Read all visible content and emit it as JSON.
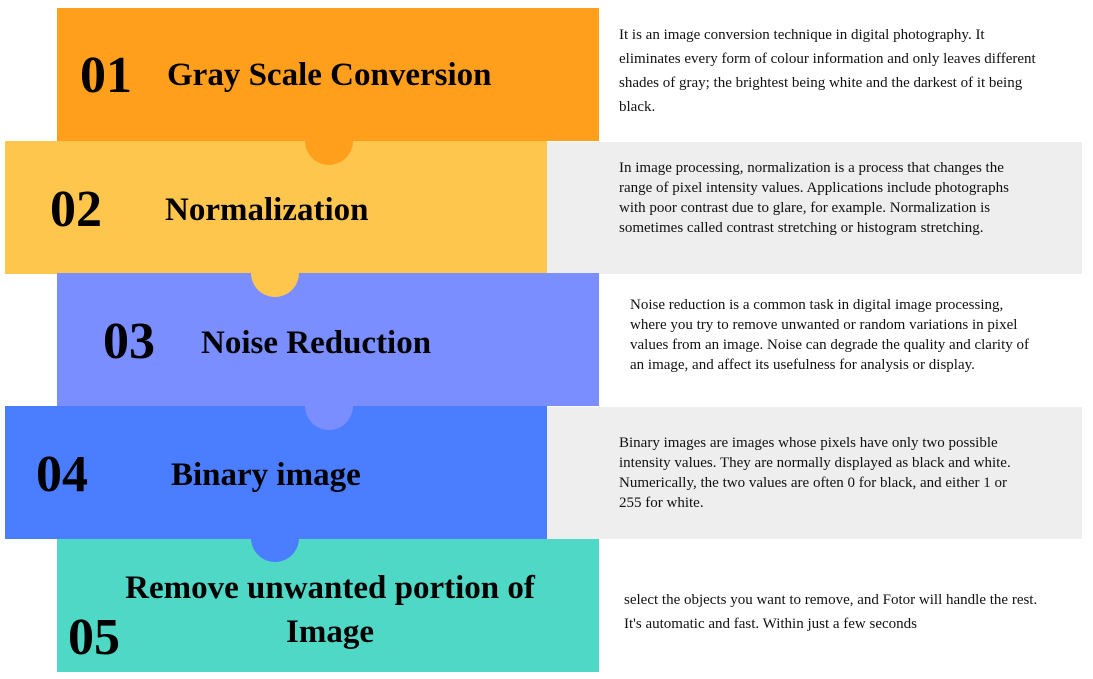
{
  "colors": {
    "step1": "#FF9F1C",
    "step2": "#FFC64E",
    "step3": "#7A8EFF",
    "step4": "#4A7DFF",
    "step5": "#4FD8C6",
    "desc_bg": "#EEEEEE"
  },
  "steps": [
    {
      "number": "01",
      "title": "Gray Scale Conversion",
      "description": "It is an image conversion technique in digital photography. It eliminates every form of colour information and only leaves different shades of gray; the brightest being white and the darkest of it being black."
    },
    {
      "number": "02",
      "title": "Normalization",
      "description": "In image processing, normalization is a process that changes the range of pixel intensity values. Applications include photographs with poor contrast due to glare, for example. Normalization is sometimes called contrast stretching or histogram stretching."
    },
    {
      "number": "03",
      "title": "Noise Reduction",
      "description": "Noise reduction is a common task in digital image processing, where you try to remove unwanted or random variations in pixel values from an image. Noise can degrade the quality and clarity of an image, and affect its usefulness for analysis or display."
    },
    {
      "number": "04",
      "title": "Binary image",
      "description": "Binary images are images whose pixels have only two possible intensity values. They are normally displayed as black and white. Numerically, the two values are often 0 for black, and either 1 or 255 for white."
    },
    {
      "number": "05",
      "title": "Remove unwanted portion of Image",
      "description": "select the objects you want to remove, and Fotor will handle the rest. It's automatic and fast. Within just a few seconds"
    }
  ]
}
